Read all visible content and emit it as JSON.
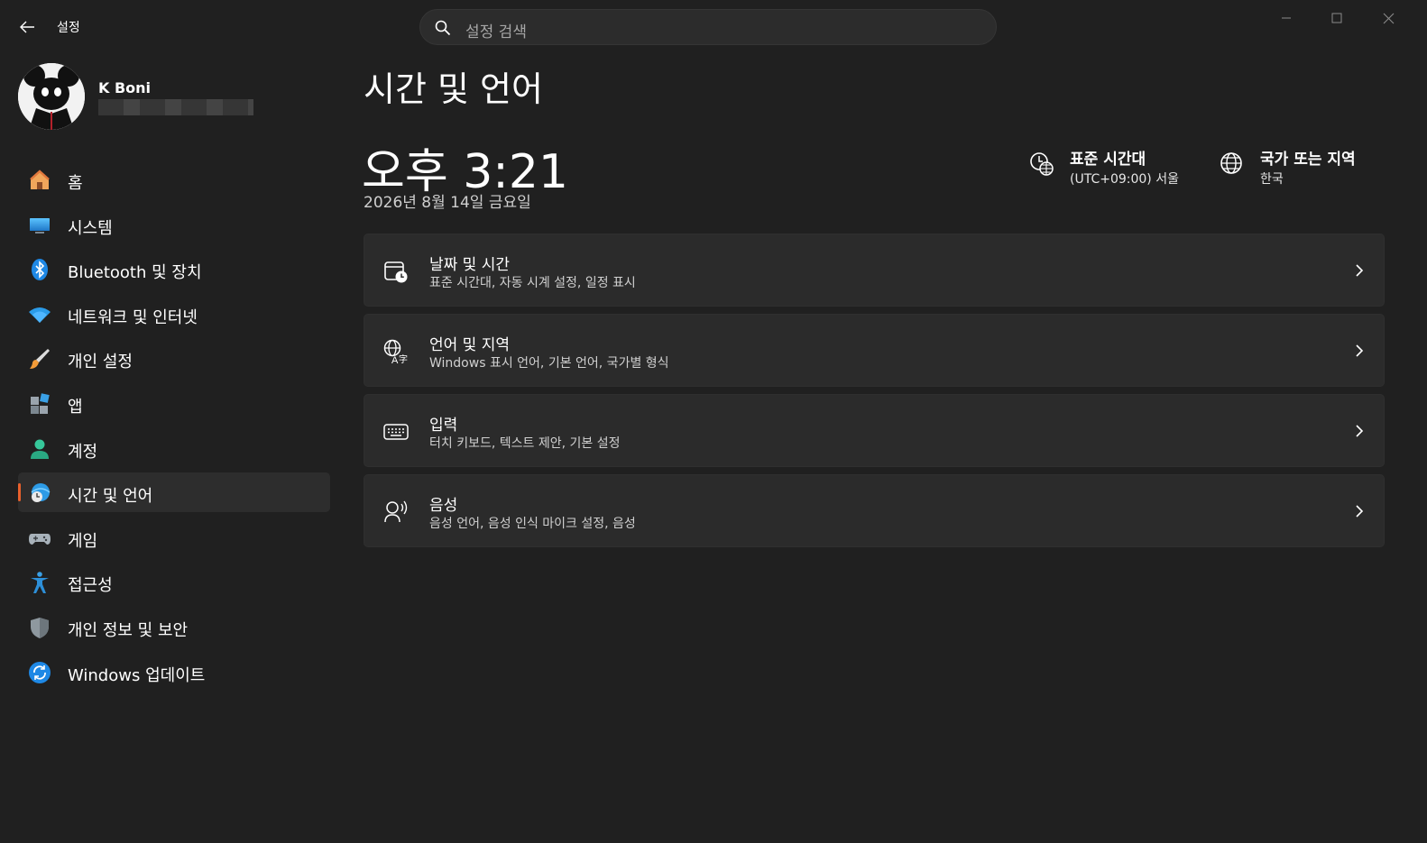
{
  "titlebar": {
    "app_title": "설정",
    "search_placeholder": "설정 검색"
  },
  "profile": {
    "name": "K Boni"
  },
  "sidebar": {
    "items": [
      {
        "label": "홈",
        "icon": "home-icon"
      },
      {
        "label": "시스템",
        "icon": "system-icon"
      },
      {
        "label": "Bluetooth 및 장치",
        "icon": "bluetooth-icon"
      },
      {
        "label": "네트워크 및 인터넷",
        "icon": "wifi-icon"
      },
      {
        "label": "개인 설정",
        "icon": "brush-icon"
      },
      {
        "label": "앱",
        "icon": "apps-icon"
      },
      {
        "label": "계정",
        "icon": "account-icon"
      },
      {
        "label": "시간 및 언어",
        "icon": "time-language-icon",
        "selected": true
      },
      {
        "label": "게임",
        "icon": "gamepad-icon"
      },
      {
        "label": "접근성",
        "icon": "accessibility-icon"
      },
      {
        "label": "개인 정보 및 보안",
        "icon": "shield-icon"
      },
      {
        "label": "Windows 업데이트",
        "icon": "update-icon"
      }
    ]
  },
  "main": {
    "title": "시간 및 언어",
    "clock": "오후 3:21",
    "date": "2026년 8월 14일 금요일",
    "timezone": {
      "title": "표준 시간대",
      "value": "(UTC+09:00) 서울"
    },
    "region": {
      "title": "국가 또는 지역",
      "value": "한국"
    },
    "cards": [
      {
        "title": "날짜 및 시간",
        "subtitle": "표준 시간대, 자동 시계 설정, 일정 표시",
        "icon": "calendar-clock-icon"
      },
      {
        "title": "언어 및 지역",
        "subtitle": "Windows 표시 언어, 기본 언어, 국가별 형식",
        "icon": "language-icon"
      },
      {
        "title": "입력",
        "subtitle": "터치 키보드, 텍스트 제안, 기본 설정",
        "icon": "keyboard-icon"
      },
      {
        "title": "음성",
        "subtitle": "음성 언어, 음성 인식 마이크 설정, 음성",
        "icon": "speech-icon"
      }
    ]
  },
  "colors": {
    "background": "#202020",
    "card": "#2b2b2b",
    "accent": "#e8602c",
    "selected_item": "#2d2d2d"
  }
}
